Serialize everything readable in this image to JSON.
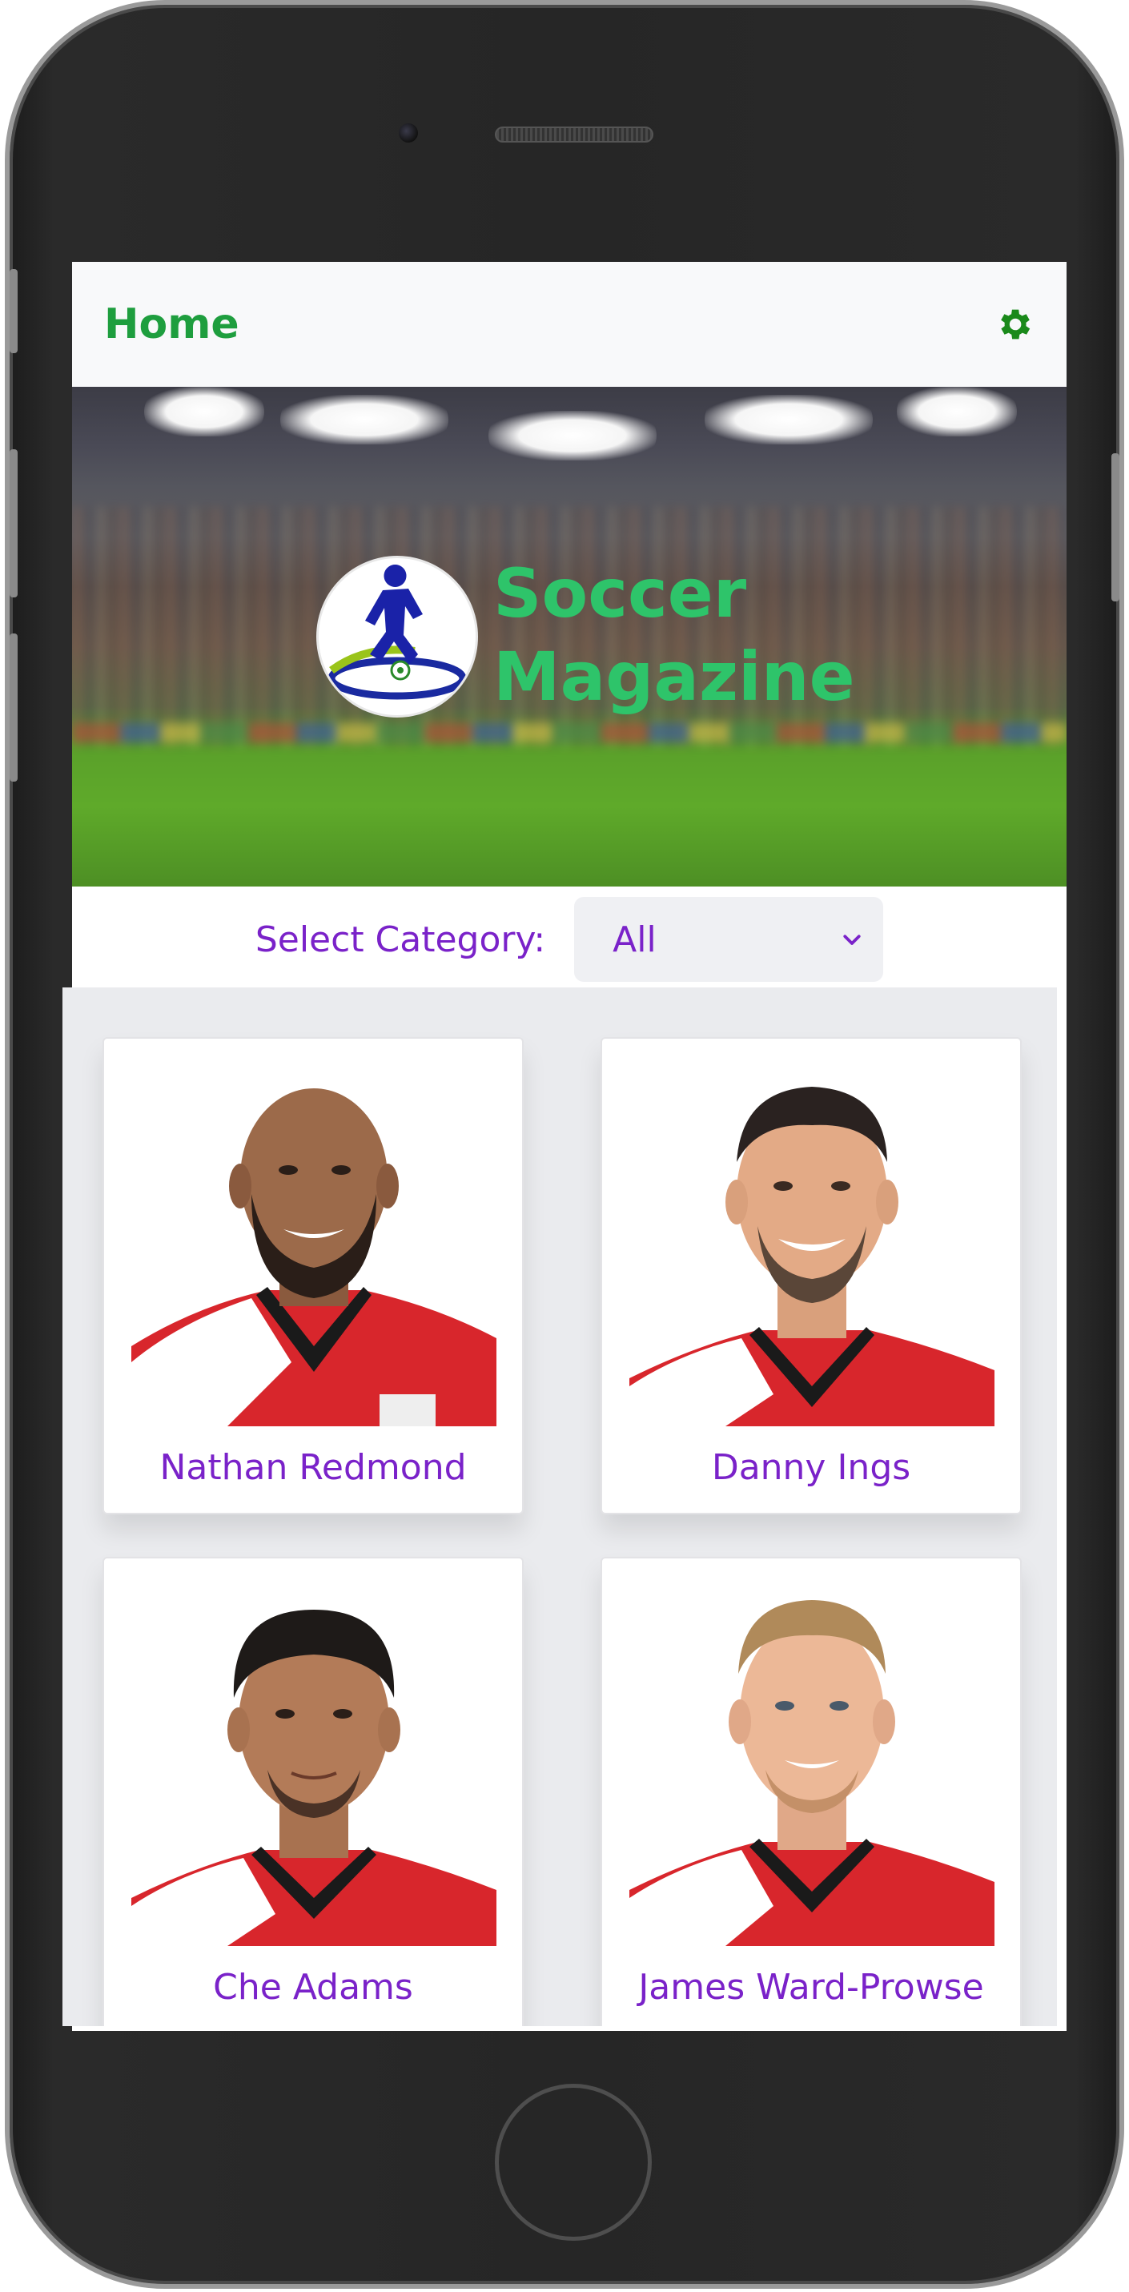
{
  "navbar": {
    "title": "Home",
    "settings_icon": "gear-icon",
    "title_color": "#1e9e3e"
  },
  "banner": {
    "brand_line1": "Soccer",
    "brand_line2": "Magazine",
    "brand_color": "#2ec46a",
    "logo_icon": "soccer-player-logo"
  },
  "category": {
    "label": "Select Category:",
    "selected": "All",
    "accent": "#7a22c9"
  },
  "players": [
    {
      "name": "Nathan Redmond",
      "icon": "arrow-circle-right-icon"
    },
    {
      "name": "Danny Ings",
      "icon": "arrow-circle-right-icon"
    },
    {
      "name": "Che Adams",
      "icon": "arrow-circle-right-icon"
    },
    {
      "name": "James Ward-Prowse",
      "icon": "arrow-circle-right-icon"
    }
  ],
  "colors": {
    "jersey_red": "#d8262c",
    "arrow_purple": "#8a0a8a"
  }
}
